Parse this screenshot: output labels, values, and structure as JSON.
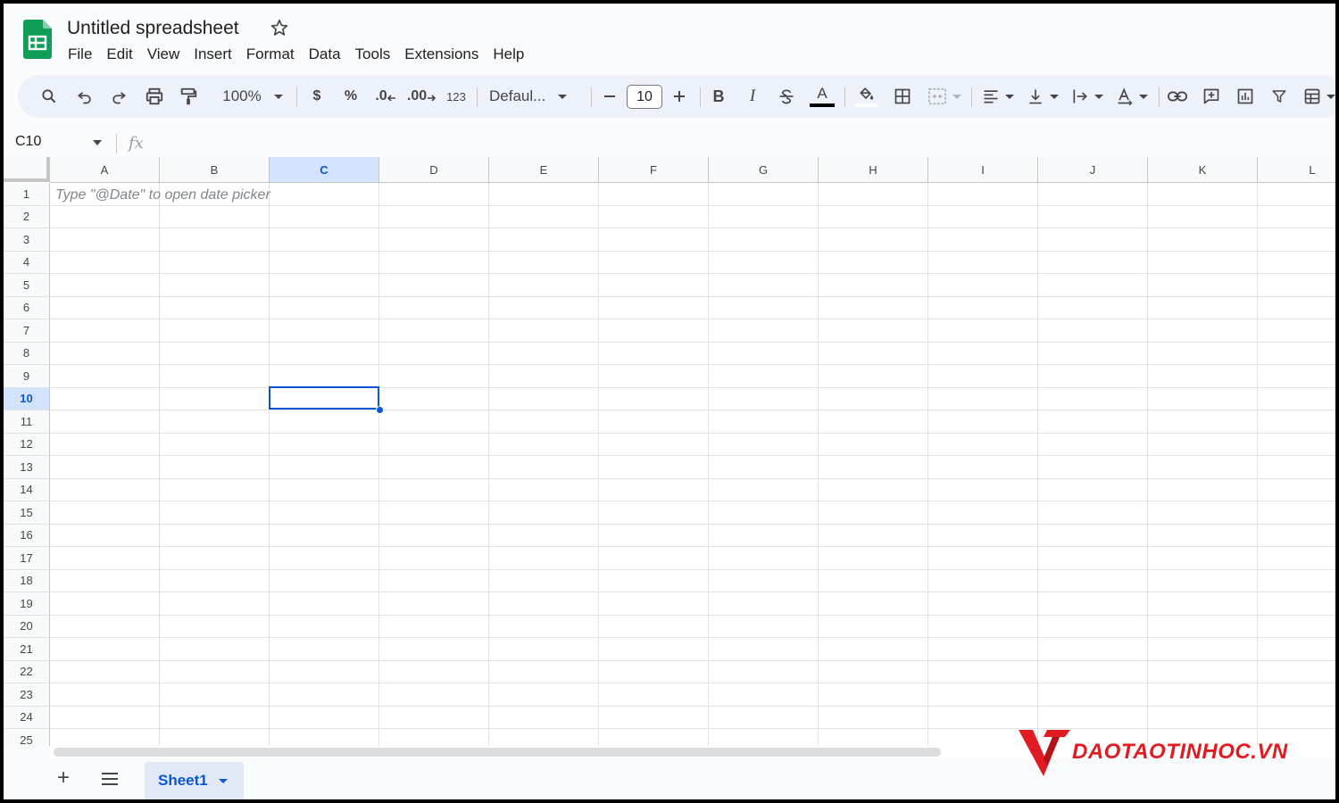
{
  "app": {
    "title": "Untitled spreadsheet",
    "brand_color": "#188038"
  },
  "menu": [
    "File",
    "Edit",
    "View",
    "Insert",
    "Format",
    "Data",
    "Tools",
    "Extensions",
    "Help"
  ],
  "toolbar": {
    "zoom": "100%",
    "currency_label": "$",
    "percent_label": "%",
    "decrease_decimal_label": ".0",
    "increase_decimal_label": ".00",
    "number_format_label": "123",
    "font": "Defaul...",
    "font_size": "10",
    "bold_label": "B",
    "italic_label": "I",
    "text_color_label": "A",
    "icons": [
      "search-icon",
      "undo-icon",
      "redo-icon",
      "print-icon",
      "paint-format-icon",
      "minus-icon",
      "plus-icon",
      "strikethrough-icon",
      "fill-color-icon",
      "borders-icon",
      "merge-cells-icon",
      "align-left-icon",
      "vertical-align-icon",
      "text-wrap-icon",
      "text-rotation-icon",
      "link-icon",
      "comment-icon",
      "chart-icon",
      "filter-icon",
      "table-icon"
    ]
  },
  "formula_bar": {
    "name_box": "C10",
    "fx_label": "fx"
  },
  "grid": {
    "columns": [
      "A",
      "B",
      "C",
      "D",
      "E",
      "F",
      "G",
      "H",
      "I",
      "J",
      "K",
      "L"
    ],
    "rows": [
      "1",
      "2",
      "3",
      "4",
      "5",
      "6",
      "7",
      "8",
      "9",
      "10",
      "11",
      "12",
      "13",
      "14",
      "15",
      "16",
      "17",
      "18",
      "19",
      "20",
      "21",
      "22",
      "23",
      "24",
      "25"
    ],
    "selected_column": "C",
    "selected_row": "10",
    "cell_hint": "Type \"@Date\" to open date picker"
  },
  "sheets": {
    "add_label": "+",
    "tabs": [
      {
        "label": "Sheet1"
      }
    ]
  },
  "watermark": {
    "text": "DAOTAOTINHOC.VN",
    "color": "#e11b22"
  }
}
